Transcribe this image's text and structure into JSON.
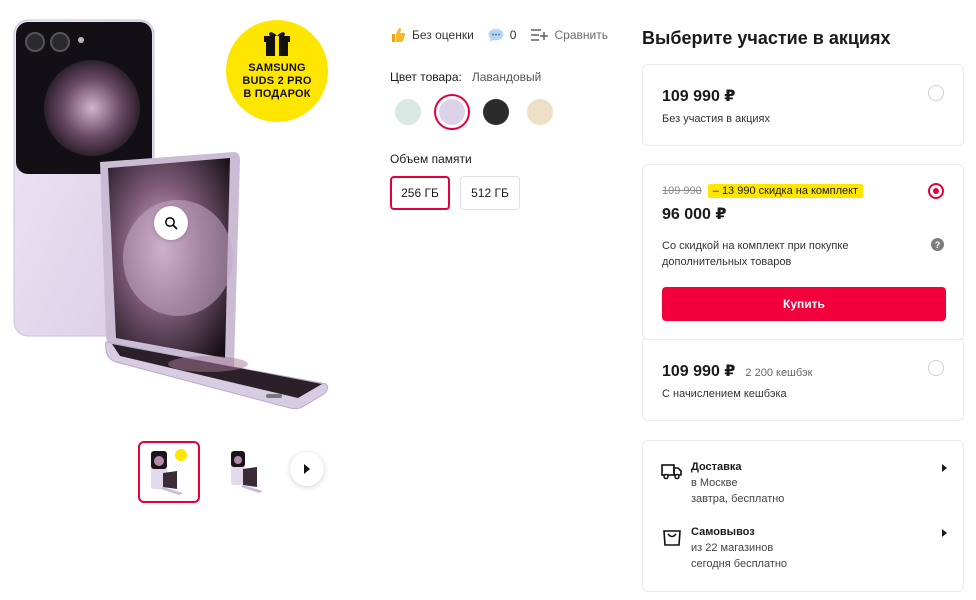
{
  "promo": {
    "badge_text": "SAMSUNG\nBUDS 2 PRO\nВ ПОДАРОК"
  },
  "meta": {
    "rating_label": "Без оценки",
    "reviews_count": "0",
    "compare_label": "Сравнить"
  },
  "color": {
    "label": "Цвет товара:",
    "value": "Лавандовый",
    "swatches": [
      {
        "name": "mint",
        "hex": "#d9e9e3"
      },
      {
        "name": "lavender",
        "hex": "#dcd2ea"
      },
      {
        "name": "graphite",
        "hex": "#2b2b2b"
      },
      {
        "name": "cream",
        "hex": "#ede0c7"
      }
    ],
    "selected_index": 1
  },
  "memory": {
    "label": "Объем памяти",
    "options": [
      "256 ГБ",
      "512 ГБ"
    ],
    "selected_index": 0
  },
  "offers": {
    "title": "Выберите участие в акциях",
    "plain": {
      "price": "109 990 ₽",
      "caption": "Без участия в акциях"
    },
    "bundle": {
      "old_price": "109 990",
      "discount": "– 13 990  скидка на комплект",
      "price": "96 000 ₽",
      "caption": "Со скидкой на комплект при покупке дополнительных товаров",
      "buy_label": "Купить"
    },
    "cashback": {
      "price": "109 990 ₽",
      "cashback": "2 200 кешбэк",
      "caption": "С начислением кешбэка"
    }
  },
  "delivery": {
    "courier": {
      "title": "Доставка",
      "line1": "в Москве",
      "line2": "завтра, бесплатно"
    },
    "pickup": {
      "title": "Самовывоз",
      "line1": "из 22 магазинов",
      "line2": "сегодня бесплатно"
    }
  },
  "colors": {
    "accent": "#e3003b",
    "buy_button": "#f2003c",
    "promo_yellow": "#ffe600"
  }
}
